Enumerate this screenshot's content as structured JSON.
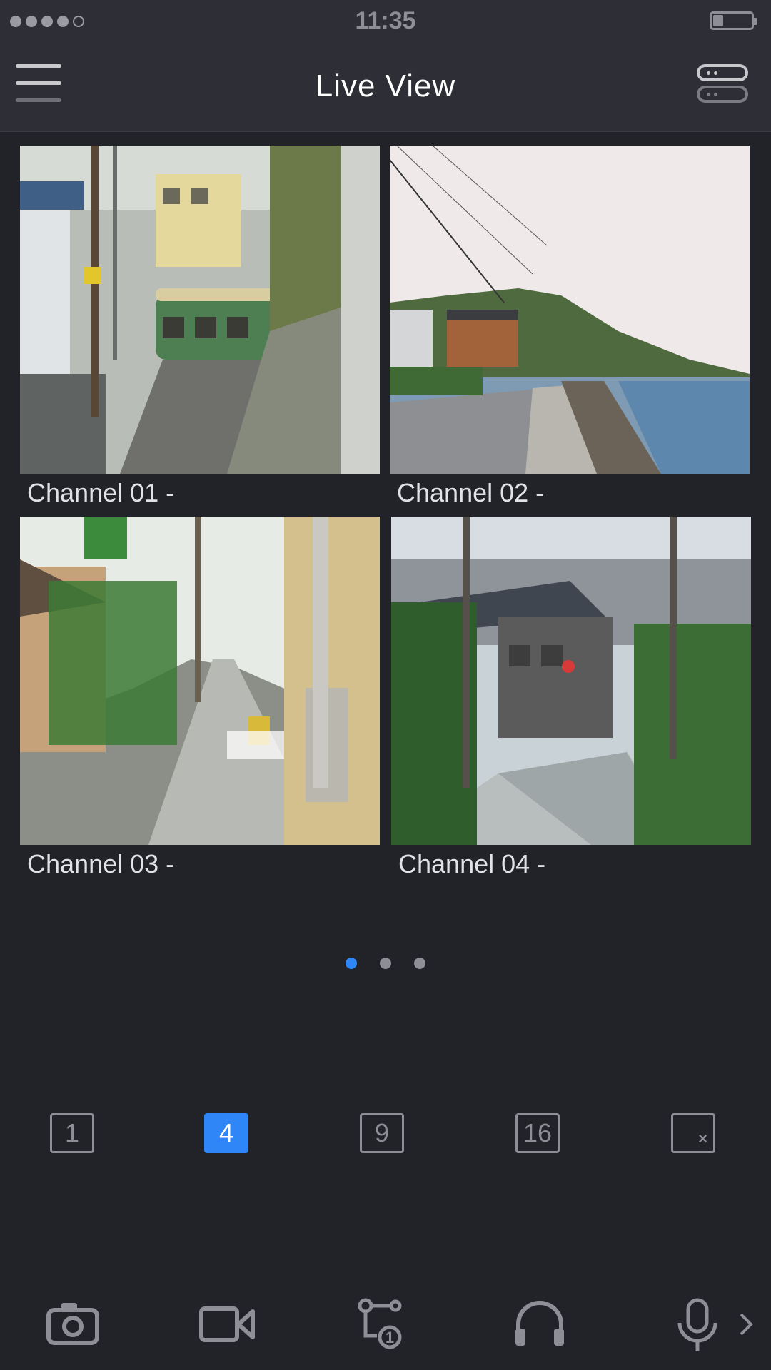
{
  "status_bar": {
    "time": "11:35"
  },
  "header": {
    "title": "Live View"
  },
  "channels": [
    {
      "label": "Channel 01 -"
    },
    {
      "label": "Channel 02 -"
    },
    {
      "label": "Channel 03 -"
    },
    {
      "label": "Channel 04 -"
    }
  ],
  "pager": {
    "pages": 3,
    "current": 1
  },
  "layout": {
    "options": [
      "1",
      "4",
      "9",
      "16"
    ],
    "selected": "4",
    "close_icon": "close-split-icon"
  },
  "toolbar": {
    "tools": [
      "camera-icon",
      "video-record-icon",
      "ptz-icon",
      "headphones-icon",
      "microphone-icon",
      "chevron-right-icon"
    ]
  },
  "colors": {
    "accent": "#2f86f6",
    "background": "#222329",
    "header": "#2e2f36"
  }
}
